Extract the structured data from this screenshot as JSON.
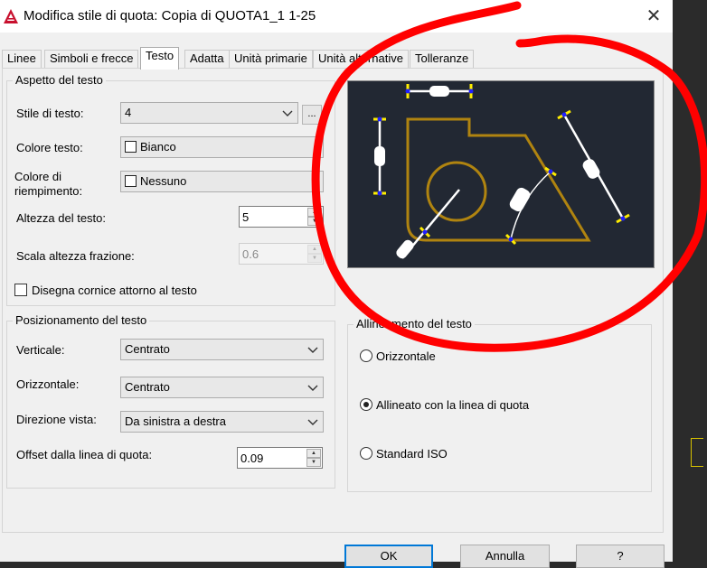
{
  "window": {
    "title": "Modifica stile di quota: Copia di QUOTA1_1 1-25",
    "close_glyph": "✕",
    "app_icon": "autocad-icon"
  },
  "tabs": [
    {
      "label": "Linee",
      "active": false
    },
    {
      "label": "Simboli e frecce",
      "active": false
    },
    {
      "label": "Testo",
      "active": true
    },
    {
      "label": "Adatta",
      "active": false
    },
    {
      "label": "Unità primarie",
      "active": false
    },
    {
      "label": "Unità alternative",
      "active": false
    },
    {
      "label": "Tolleranze",
      "active": false
    }
  ],
  "text_appearance": {
    "title": "Aspetto del testo",
    "style_label": "Stile di testo:",
    "style_value": "4",
    "style_button": "...",
    "color_label": "Colore testo:",
    "color_value": "Bianco",
    "fill_label_1": "Colore di",
    "fill_label_2": "riempimento:",
    "fill_value": "Nessuno",
    "height_label": "Altezza del testo:",
    "height_value": "5",
    "fraction_label": "Scala altezza frazione:",
    "fraction_value": "0.6",
    "frame_label": "Disegna cornice attorno al testo",
    "frame_checked": false
  },
  "text_placement": {
    "title": "Posizionamento del testo",
    "vertical_label": "Verticale:",
    "vertical_value": "Centrato",
    "horizontal_label": "Orizzontale:",
    "horizontal_value": "Centrato",
    "direction_label": "Direzione vista:",
    "direction_value": "Da sinistra a destra",
    "offset_label": "Offset dalla linea di quota:",
    "offset_value": "0.09"
  },
  "text_alignment": {
    "title": "Allineamento del testo",
    "options": [
      {
        "label": "Orizzontale",
        "selected": false
      },
      {
        "label": "Allineato con la linea di quota",
        "selected": true
      },
      {
        "label": "Standard ISO",
        "selected": false
      }
    ]
  },
  "buttons": {
    "ok": "OK",
    "cancel": "Annulla",
    "help": "?"
  },
  "colors": {
    "preview_bg": "#222833",
    "shape_outline": "#b08410",
    "dimension_tick": "#ffee00",
    "dimension_point": "#2020ff",
    "annotation": "#ff0000",
    "ok_border": "#0078d7"
  }
}
